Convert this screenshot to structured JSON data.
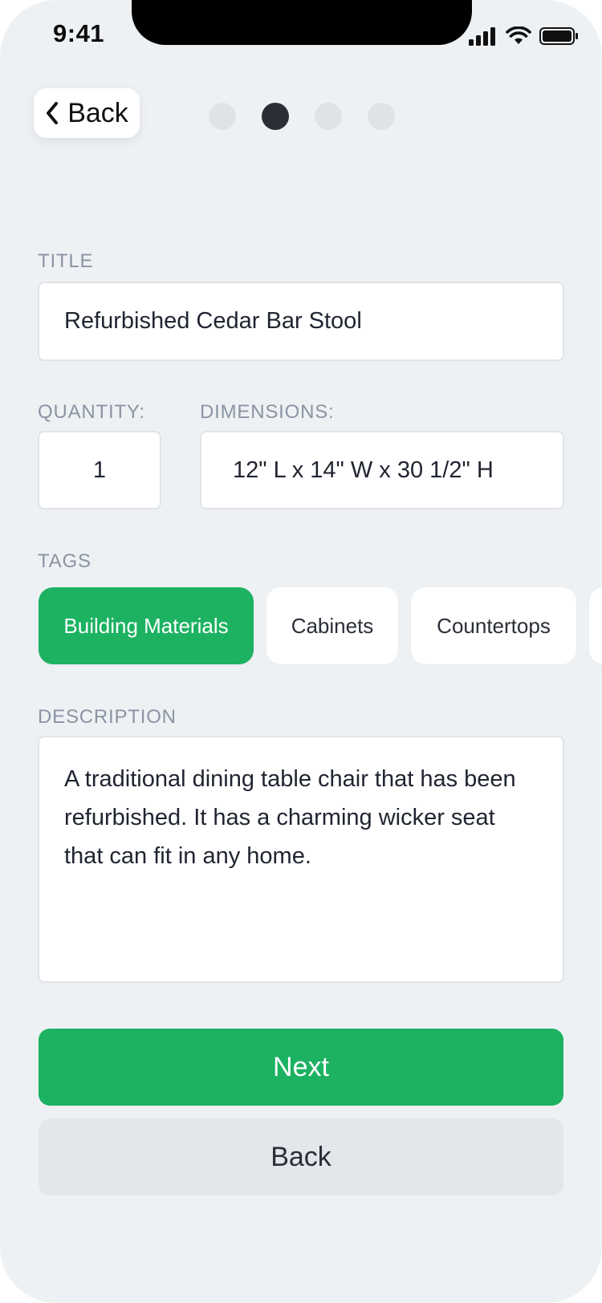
{
  "status_bar": {
    "time": "9:41"
  },
  "header": {
    "back_label": "Back",
    "steps_total": 4,
    "current_step": 2
  },
  "form": {
    "title": {
      "label": "TITLE",
      "value": "Refurbished Cedar Bar Stool"
    },
    "quantity": {
      "label": "QUANTITY:",
      "value": "1"
    },
    "dimensions": {
      "label": "DIMENSIONS:",
      "value": "12\" L x 14\" W x 30 1/2\" H"
    },
    "tags": {
      "label": "TAGS",
      "items": [
        {
          "label": "Building Materials",
          "selected": true
        },
        {
          "label": "Cabinets",
          "selected": false
        },
        {
          "label": "Countertops",
          "selected": false
        }
      ]
    },
    "description": {
      "label": "DESCRIPTION",
      "value": "A traditional dining table chair that has been refurbished. It has a charming wicker seat that can fit in any home."
    }
  },
  "actions": {
    "next_label": "Next",
    "back_label": "Back"
  },
  "colors": {
    "accent": "#1cb262",
    "background": "#eef1f4",
    "muted_text": "#8a94a3"
  }
}
